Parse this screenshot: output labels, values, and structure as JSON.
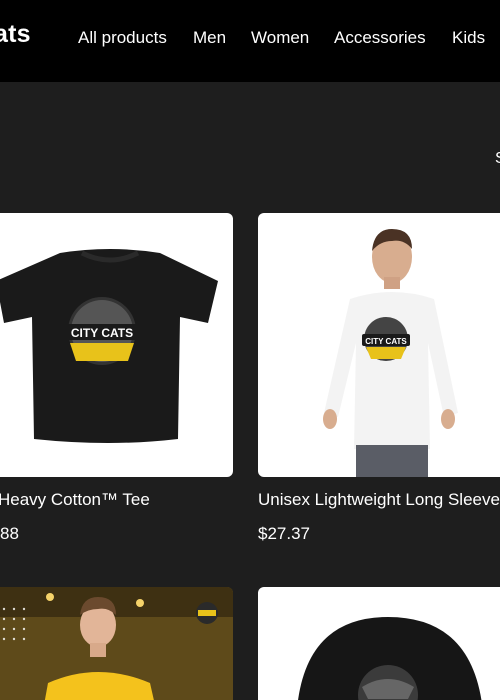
{
  "header": {
    "brand": "ats",
    "nav": [
      {
        "label": "All products"
      },
      {
        "label": "Men"
      },
      {
        "label": "Women"
      },
      {
        "label": "Accessories"
      },
      {
        "label": "Kids"
      }
    ]
  },
  "edge_text": "S",
  "products": [
    {
      "title": "Heavy Cotton™ Tee",
      "price": "88",
      "logo_text": "CITY CATS"
    },
    {
      "title": "Unisex Lightweight Long Sleeve T",
      "price": "$27.37",
      "logo_text": "CITY CATS"
    }
  ],
  "colors": {
    "header_bg": "#000000",
    "page_bg": "#1e1e1e",
    "card_bg": "#ffffff",
    "accent_yellow": "#e8c21a"
  }
}
